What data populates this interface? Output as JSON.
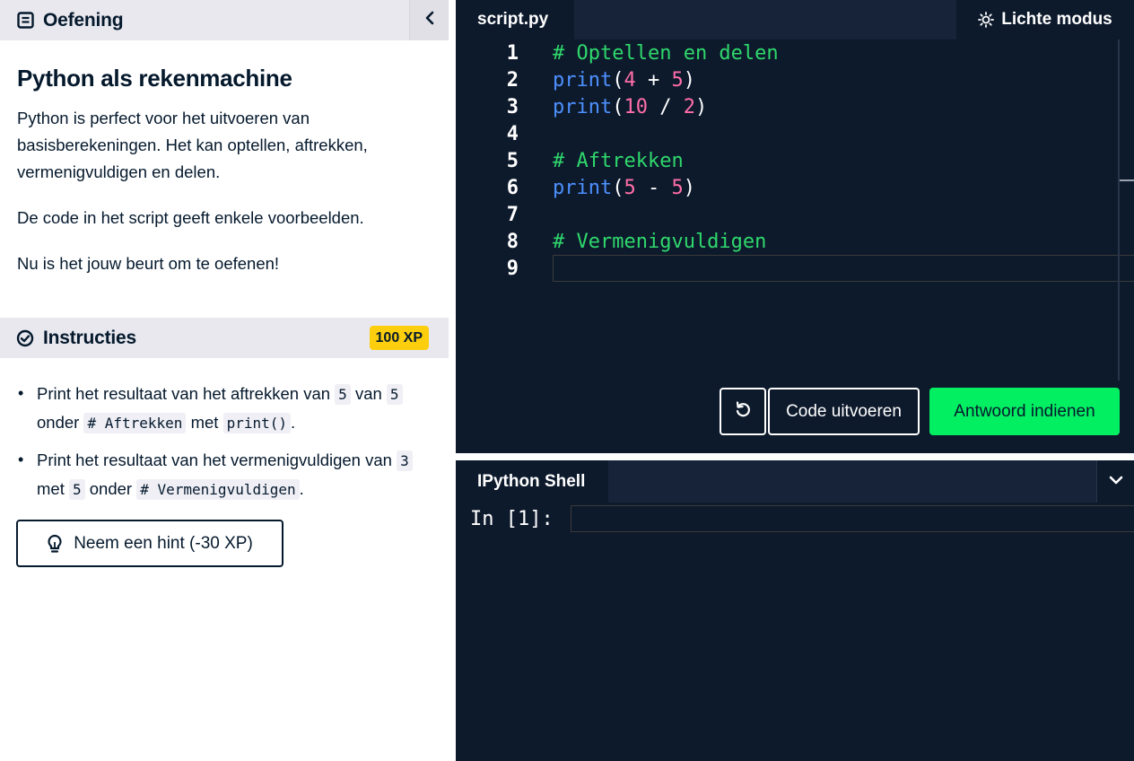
{
  "exercise": {
    "section_label": "Oefening",
    "title": "Python als rekenmachine",
    "paragraphs": [
      "Python is perfect voor het uitvoeren van basisberekeningen. Het kan optellen, aftrekken, vermenigvuldigen en delen.",
      "De code in het script geeft enkele voorbeelden.",
      "Nu is het jouw beurt om te oefenen!"
    ]
  },
  "instructions": {
    "section_label": "Instructies",
    "xp": "100 XP",
    "item1": {
      "t1": "Print het resultaat van het aftrekken van ",
      "c1": "5",
      "t2": " van ",
      "c2": "5",
      "t3": " onder ",
      "c3": "# Aftrekken",
      "t4": " met ",
      "c4": "print()",
      "t5": "."
    },
    "item2": {
      "t1": "Print het resultaat van het vermenigvuldigen van ",
      "c1": "3",
      "t2": " met ",
      "c2": "5",
      "t3": " onder ",
      "c3": "# Vermenigvuldigen",
      "t4": "."
    },
    "hint_label": "Neem een hint (-30 XP)"
  },
  "editor": {
    "tab_label": "script.py",
    "theme_label": "Lichte modus",
    "line_numbers": [
      "1",
      "2",
      "3",
      "4",
      "5",
      "6",
      "7",
      "8",
      "9"
    ],
    "lines": {
      "l1": "# Optellen en delen",
      "l2": {
        "fn": "print",
        "open": "(",
        "a": "4",
        "op": " + ",
        "b": "5",
        "close": ")"
      },
      "l3": {
        "fn": "print",
        "open": "(",
        "a": "10",
        "op": " / ",
        "b": "2",
        "close": ")"
      },
      "l5": "# Aftrekken",
      "l6": {
        "fn": "print",
        "open": "(",
        "a": "5",
        "op": " - ",
        "b": "5",
        "close": ")"
      },
      "l8": "# Vermenigvuldigen"
    },
    "run_label": "Code uitvoeren",
    "submit_label": "Antwoord indienen"
  },
  "shell": {
    "tab_label": "IPython Shell",
    "prompt": "In [1]:",
    "input_value": ""
  },
  "colors": {
    "accent_green": "#03ef62",
    "xp_yellow": "#fcce0d",
    "editor_bg": "#0d1a2c",
    "keyword_blue": "#4d90fe",
    "number_pink": "#ff6ea9",
    "comment_green": "#2fd86c"
  }
}
